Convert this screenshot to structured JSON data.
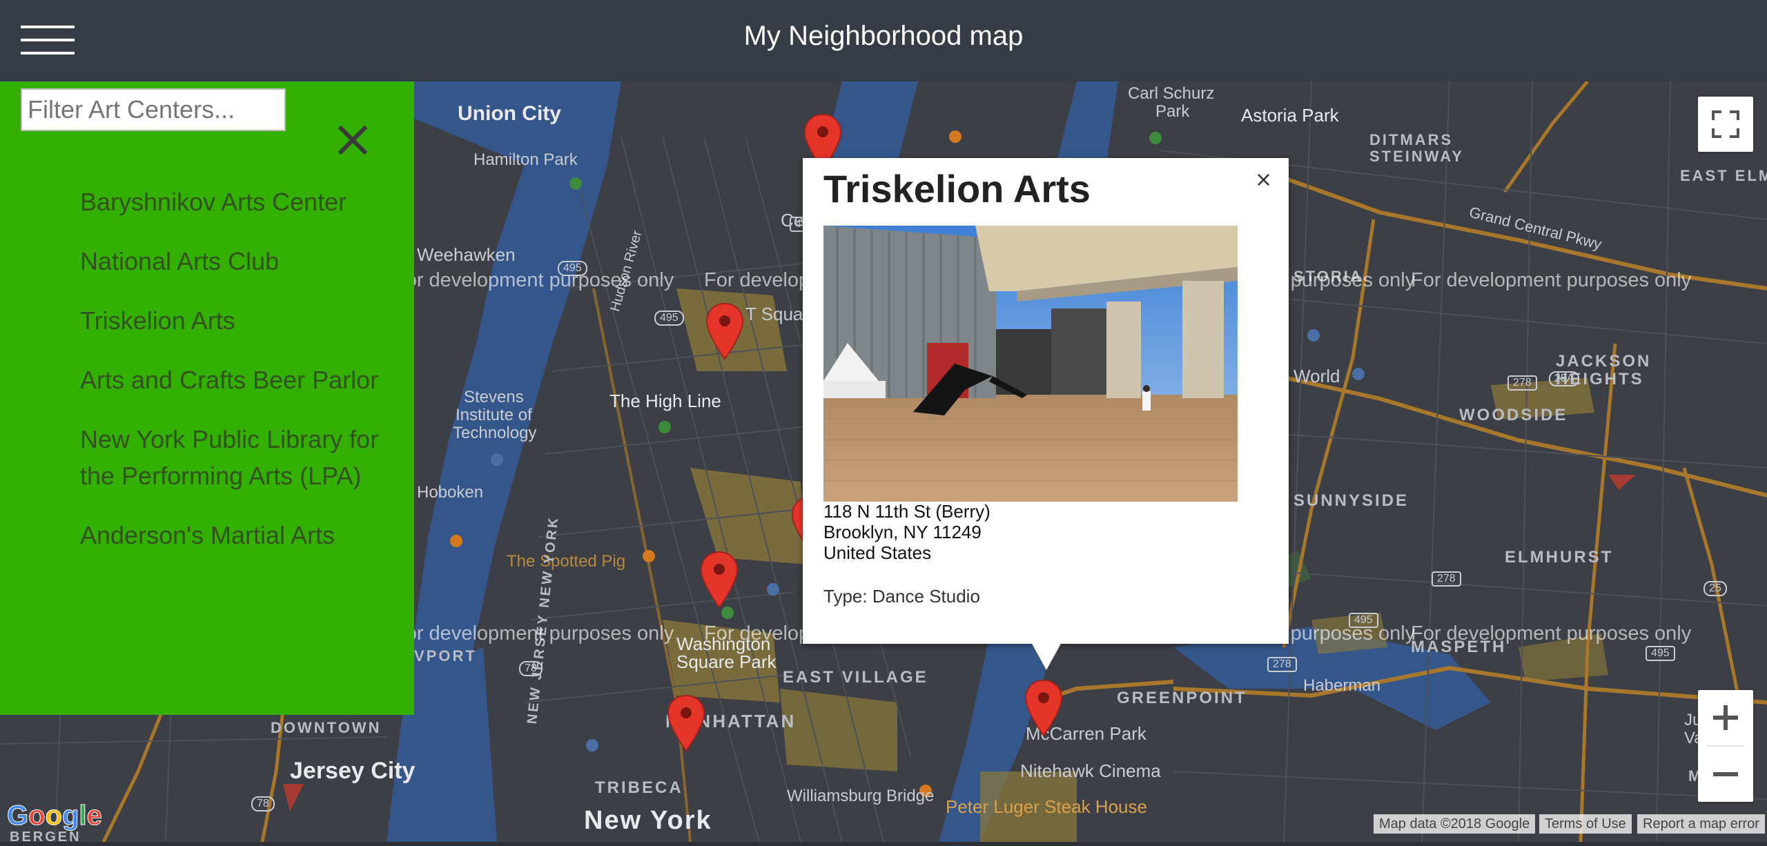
{
  "header": {
    "title": "My Neighborhood map",
    "menu_icon": "hamburger-menu-icon"
  },
  "sidebar": {
    "filter_placeholder": "Filter Art Centers...",
    "filter_value": "",
    "close_icon": "close-icon",
    "items": [
      "Baryshnikov Arts Center",
      "National Arts Club",
      "Triskelion Arts",
      "Arts and Crafts Beer Parlor",
      "New York Public Library for the Performing Arts (LPA)",
      "Anderson's Martial Arts"
    ]
  },
  "infowindow": {
    "title": "Triskelion Arts",
    "address_line1": "118 N 11th St (Berry)",
    "address_line2": "Brooklyn, NY 11249",
    "address_line3": "United States",
    "type": "Type: Dance Studio",
    "close_label": "×"
  },
  "map": {
    "watermark": "For development purposes only",
    "labels": {
      "union_city": "Union City",
      "hamilton_park": "Hamilton Park",
      "weehawken": "Weehawken",
      "stevens_l1": "Stevens",
      "stevens_l2": "Institute of",
      "stevens_l3": "Technology",
      "hoboken": "Hoboken",
      "high_line": "The High Line",
      "spotted_pig": "The Spotted Pig",
      "washington_l1": "Washington",
      "washington_l2": "Square Park",
      "east_village": "EAST VILLAGE",
      "downtown": "DOWNTOWN",
      "jersey_city": "Jersey City",
      "tribeca": "TRIBECA",
      "new_york": "New York",
      "williamsburg_bridge": "Williamsburg Bridge",
      "mccarren": "McCarren Park",
      "nitehawk": "Nitehawk Cinema",
      "peter_luger": "Peter Luger Steak House",
      "greenpoint": "GREENPOINT",
      "haberman": "Haberman",
      "maspeth": "MASPETH",
      "elmhurst": "ELMHURST",
      "sunnyside": "SUNNYSIDE",
      "woodside": "WOODSIDE",
      "jackson_l1": "JACKSON",
      "jackson_l2": "HEIGHTS",
      "astoria_park": "Astoria Park",
      "ditmars_l1": "DITMARS",
      "ditmars_l2": "STEINWAY",
      "east_elmhurst": "EAST ELMH",
      "carl_l1": "Carl Schurz",
      "carl_l2": "Park",
      "grand_central": "Grand Central Pkwy",
      "hudson_river": "Hudson River",
      "new_jersey_york": "NEW JERSEY   NEW YORK",
      "manhattan": "MANHATTAN",
      "juniper_l1": "Juniper",
      "juniper_l2": "Valley Pa",
      "middle": "MIDDL",
      "village_partial": "VPORT",
      "storia_partial": "STORIA",
      "world_partial": "World",
      "cen_partial": "Cen",
      "t_square": "T Square",
      "bergen_partial": "BERGEN"
    },
    "shields": [
      "495",
      "495",
      "278",
      "278",
      "278",
      "278",
      "25A",
      "495",
      "495",
      "25",
      "495",
      "78",
      "78"
    ]
  },
  "controls": {
    "fullscreen_icon": "fullscreen-icon",
    "zoom_in_icon": "zoom-in-icon",
    "zoom_out_icon": "zoom-out-icon"
  },
  "attribution": {
    "map_data": "Map data ©2018 Google",
    "terms": "Terms of Use",
    "report": "Report a map error",
    "logo": "Google"
  }
}
